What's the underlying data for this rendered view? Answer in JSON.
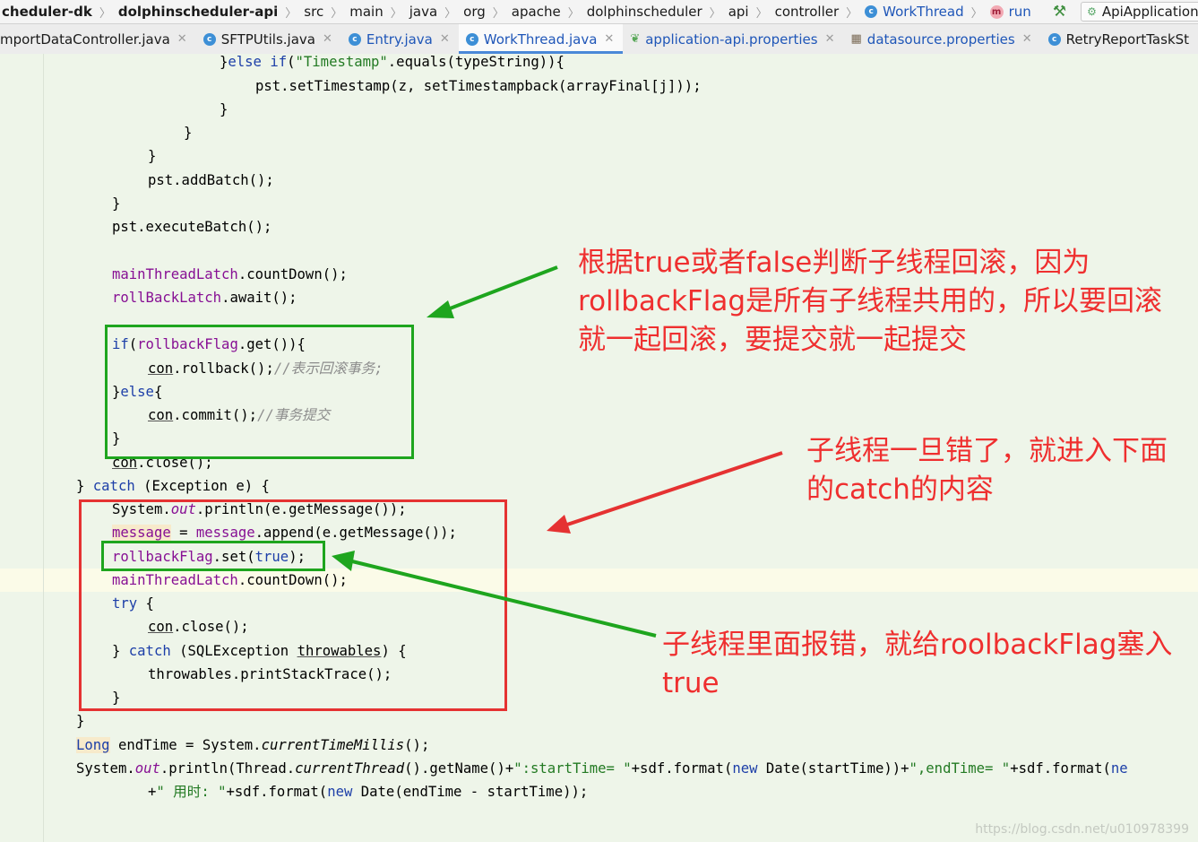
{
  "breadcrumb": {
    "items": [
      "cheduler-dk",
      "dolphinscheduler-api",
      "src",
      "main",
      "java",
      "org",
      "apache",
      "dolphinscheduler",
      "api",
      "controller"
    ],
    "class_item": "WorkThread",
    "method_item": "run",
    "run_config": "ApiApplicationServer"
  },
  "tabs": [
    "mportDataController.java",
    "SFTPUtils.java",
    "Entry.java",
    "WorkThread.java",
    "application-api.properties",
    "datasource.properties",
    "RetryReportTaskSt"
  ],
  "active_tab": "WorkThread.java",
  "code": {
    "l01_close": "}",
    "l01_else": "else",
    "l01_if": "if",
    "l01_open": "(",
    "l01_str": "\"Timestamp\"",
    "l01_rest": ".equals(typeString)){",
    "l02": "pst.setTimestamp(z, setTimestampback(arrayFinal[j]));",
    "l03": "}",
    "l04": "}",
    "l05": "}",
    "l06": "pst.addBatch();",
    "l07": "}",
    "l08": "pst.executeBatch();",
    "l10_field": "mainThreadLatch",
    "l10_rest": ".countDown();",
    "l11_field": "rollBackLatch",
    "l11_rest": ".await();",
    "l13_kw": "if",
    "l13_open": "(",
    "l13_field": "rollbackFlag",
    "l13_rest": ".get()){",
    "l14_con": "con",
    "l14_rest": ".rollback();",
    "l14_comment": "//表示回滚事务;",
    "l15_close": "}",
    "l15_kw": "else",
    "l15_open": "{",
    "l16_con": "con",
    "l16_rest": ".commit();",
    "l16_comment": "//事务提交",
    "l17": "}",
    "l18_con": "con",
    "l18_rest": ".close();",
    "l19_close": "} ",
    "l19_kw": "catch",
    "l19_rest": " (Exception e) {",
    "l20_a": "System.",
    "l20_out": "out",
    "l20_b": ".println(e.getMessage());",
    "l21_a": "message",
    "l21_eq": " = ",
    "l21_b": "message",
    "l21_c": ".append(e.getMessage());",
    "l22_field": "rollbackFlag",
    "l22_a": ".set(",
    "l22_true": "true",
    "l22_b": ");",
    "l23_field": "mainThreadLatch",
    "l23_rest": ".countDown();",
    "l24_kw": "try",
    "l24_rest": " {",
    "l25_con": "con",
    "l25_rest": ".close();",
    "l26_close": "} ",
    "l26_kw": "catch",
    "l26_a": " (SQLException ",
    "l26_var": "throwables",
    "l26_b": ") {",
    "l27": "throwables.printStackTrace();",
    "l28": "}",
    "l29": "}",
    "l30_type": "Long",
    "l30_a": " endTime = System.",
    "l30_ita": "currentTimeMillis",
    "l30_b": "();",
    "l31_a": "System.",
    "l31_out": "out",
    "l31_b": ".println(Thread.",
    "l31_ita": "currentThread",
    "l31_c": "().getName()+",
    "l31_s1": "\":startTime= \"",
    "l31_d": "+sdf.format(",
    "l31_new": "new",
    "l31_e": " Date(startTime))+",
    "l31_s2": "\",endTime= \"",
    "l31_f": "+sdf.format(",
    "l31_new2": "ne",
    "l32_a": "+",
    "l32_str": "\" 用时: \"",
    "l32_b": "+sdf.format(",
    "l32_new": "new",
    "l32_c": " Date(endTime - startTime));"
  },
  "annotations": {
    "note1": "根据true或者false判断子线程回滚，因为rollbackFlag是所有子线程共用的，所以要回滚就一起回滚，要提交就一起提交",
    "note2": "子线程一旦错了，就进入下面的catch的内容",
    "note3": "子线程里面报错，就给roolbackFlag塞入true"
  },
  "watermark": "https://blog.csdn.net/u010978399",
  "colors": {
    "keyword": "#1d3fa8",
    "string": "#237a23",
    "field": "#871094",
    "annotation_red": "#ef2f2f",
    "box_green": "#1ea51e",
    "box_red": "#e53232",
    "editor_bg": "#eef5e9"
  }
}
